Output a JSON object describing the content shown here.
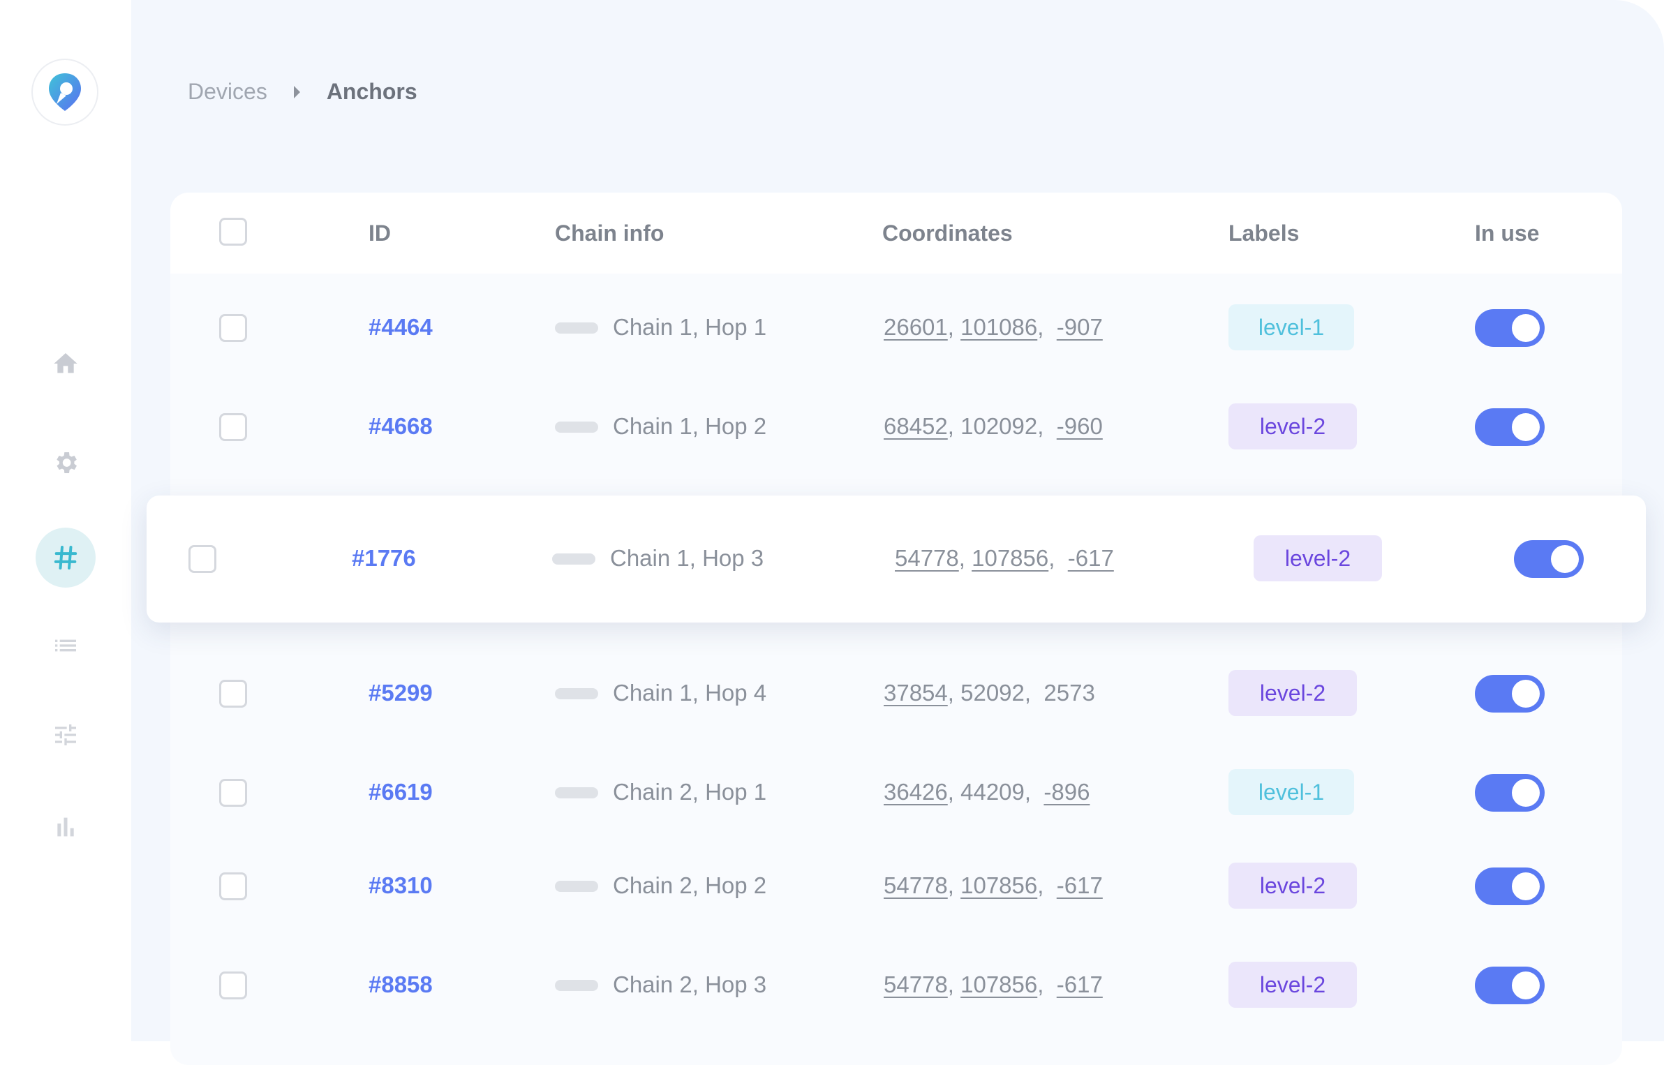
{
  "nav": {
    "logo_icon": "map-pin-logo",
    "items": [
      {
        "icon": "home-icon",
        "active": false
      },
      {
        "icon": "gear-icon",
        "active": false
      },
      {
        "icon": "hash-icon",
        "active": true
      },
      {
        "icon": "list-icon",
        "active": false
      },
      {
        "icon": "sliders-icon",
        "active": false
      },
      {
        "icon": "bar-chart-icon",
        "active": false
      }
    ]
  },
  "breadcrumb": {
    "parent": "Devices",
    "current": "Anchors"
  },
  "table": {
    "columns": {
      "id": "ID",
      "chain": "Chain info",
      "coords": "Coordinates",
      "labels": "Labels",
      "inuse": "In use"
    },
    "rows": [
      {
        "id": "#4464",
        "chain": "Chain 1, Hop 1",
        "x": "26601",
        "y": "101086",
        "z": "-907",
        "label": "level-1",
        "in_use": true
      },
      {
        "id": "#4668",
        "chain": "Chain 1, Hop 2",
        "x": "68452",
        "y": "102092",
        "z": "-960",
        "label": "level-2",
        "in_use": true
      },
      {
        "id": "#1776",
        "chain": "Chain 1, Hop 3",
        "x": "54778",
        "y": "107856",
        "z": "-617",
        "label": "level-2",
        "in_use": true
      },
      {
        "id": "#5299",
        "chain": "Chain 1, Hop 4",
        "x": "37854",
        "y": "52092",
        "z": "2573",
        "label": "level-2",
        "in_use": true
      },
      {
        "id": "#6619",
        "chain": "Chain 2, Hop 1",
        "x": "36426",
        "y": "44209",
        "z": "-896",
        "label": "level-1",
        "in_use": true
      },
      {
        "id": "#8310",
        "chain": "Chain 2, Hop 2",
        "x": "54778",
        "y": "107856",
        "z": "-617",
        "label": "level-2",
        "in_use": true
      },
      {
        "id": "#8858",
        "chain": "Chain 2, Hop 3",
        "x": "54778",
        "y": "107856",
        "z": "-617",
        "label": "level-2",
        "in_use": true
      }
    ]
  },
  "colors": {
    "accent": "#5a7af3",
    "level1_bg": "#e4f5fb",
    "level1_text": "#4fc0dc",
    "level2_bg": "#ebe6fb",
    "level2_text": "#6a46de"
  }
}
